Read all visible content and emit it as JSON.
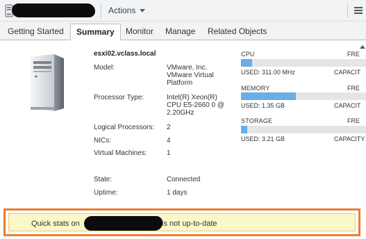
{
  "header": {
    "actions_label": "Actions"
  },
  "tabs": [
    {
      "label": "Getting Started"
    },
    {
      "label": "Summary"
    },
    {
      "label": "Monitor"
    },
    {
      "label": "Manage"
    },
    {
      "label": "Related Objects"
    }
  ],
  "host": {
    "name": "esxi02.vclass.local",
    "model_label": "Model:",
    "model_value": "VMware, Inc. VMware Virtual Platform",
    "processor_label": "Processor Type:",
    "processor_value": "Intel(R) Xeon(R) CPU E5-2660 0 @ 2.20GHz",
    "logical_label": "Logical Processors:",
    "logical_value": "2",
    "nics_label": "NICs:",
    "nics_value": "4",
    "vms_label": "Virtual Machines:",
    "vms_value": "1",
    "state_label": "State:",
    "state_value": "Connected",
    "uptime_label": "Uptime:",
    "uptime_value": "1 days"
  },
  "resources": {
    "cpu": {
      "name": "CPU",
      "free": "FRE",
      "used": "USED: 311.00 MHz",
      "capacity": "CAPACIT",
      "used_fraction": 0.09
    },
    "memory": {
      "name": "MEMORY",
      "free": "FRE",
      "used": "USED: 1.35 GB",
      "capacity": "CAPACIT",
      "used_fraction": 0.44
    },
    "storage": {
      "name": "STORAGE",
      "free": "FRE",
      "used": "USED: 3.21 GB",
      "capacity": "CAPACITY",
      "used_fraction": 0.05
    }
  },
  "warning": {
    "prefix": "Quick stats on",
    "suffix": "is not up-to-date"
  },
  "colors": {
    "bar_fill": "#6aaee6",
    "bar_track": "#e3e6e9",
    "warning_border": "#ee7d2b",
    "warning_bg": "#fbf7c8"
  },
  "icons": [
    "host-icon",
    "menu-icon",
    "server-image",
    "scroll-up-icon"
  ]
}
